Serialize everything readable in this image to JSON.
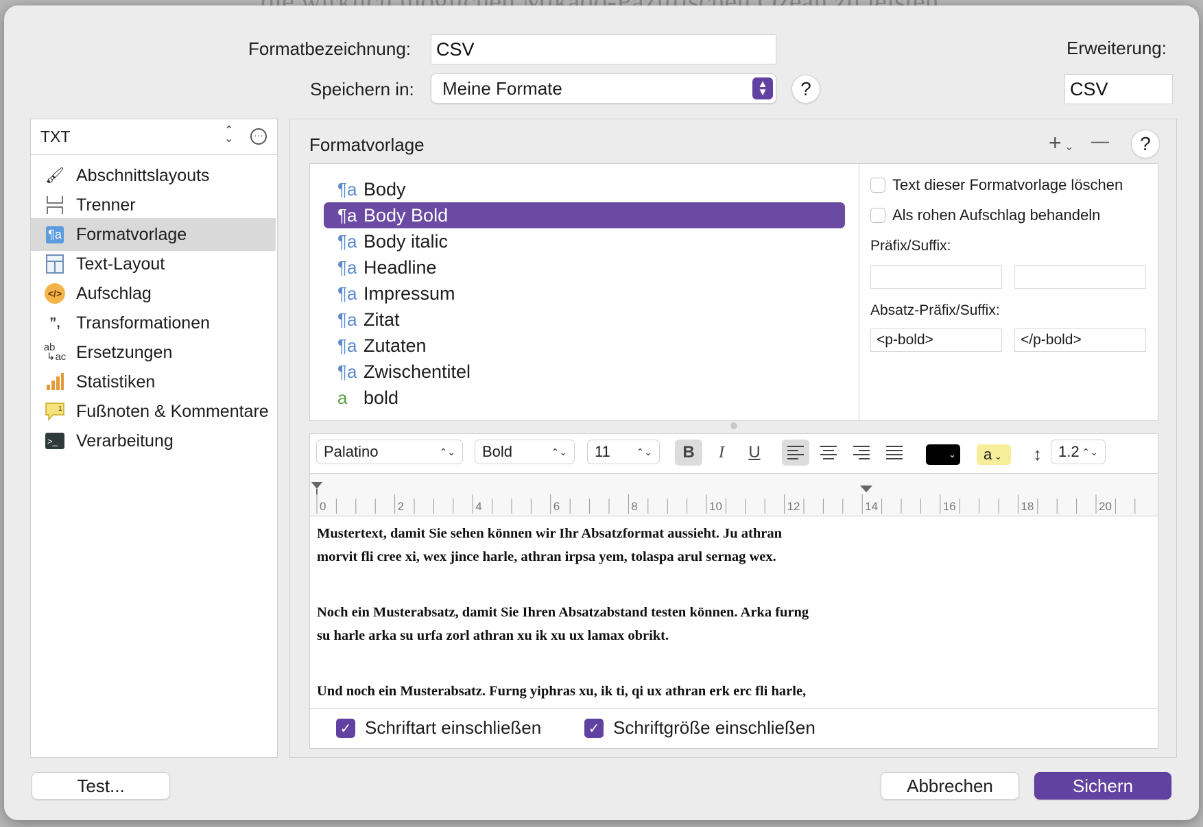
{
  "header": {
    "format_label": "Formatbezeichnung:",
    "format_value": "CSV",
    "save_label": "Speichern in:",
    "save_value": "Meine Formate",
    "help": "?",
    "extension_label": "Erweiterung:",
    "extension_value": "CSV"
  },
  "sidebar": {
    "selector": "TXT",
    "items": [
      {
        "label": "Abschnittslayouts",
        "icon": "brush-icon"
      },
      {
        "label": "Trenner",
        "icon": "separator-icon"
      },
      {
        "label": "Formatvorlage",
        "icon": "paragraph-style-icon"
      },
      {
        "label": "Text-Layout",
        "icon": "layout-icon"
      },
      {
        "label": "Aufschlag",
        "icon": "code-icon"
      },
      {
        "label": "Transformationen",
        "icon": "quotes-icon"
      },
      {
        "label": "Ersetzungen",
        "icon": "replace-icon"
      },
      {
        "label": "Statistiken",
        "icon": "chart-icon"
      },
      {
        "label": "Fußnoten & Kommentare",
        "icon": "footnote-icon"
      },
      {
        "label": "Verarbeitung",
        "icon": "terminal-icon"
      }
    ],
    "selected_index": 2
  },
  "panel": {
    "title": "Formatvorlage",
    "add": "+",
    "remove": "—",
    "help": "?",
    "styles": [
      {
        "label": "Body",
        "glyph": "¶a"
      },
      {
        "label": "Body Bold",
        "glyph": "¶a"
      },
      {
        "label": "Body italic",
        "glyph": "¶a"
      },
      {
        "label": "Headline",
        "glyph": "¶a"
      },
      {
        "label": "Impressum",
        "glyph": "¶a"
      },
      {
        "label": "Zitat",
        "glyph": "¶a"
      },
      {
        "label": "Zutaten",
        "glyph": "¶a"
      },
      {
        "label": "Zwischentitel",
        "glyph": "¶a"
      },
      {
        "label": "bold",
        "glyph": "a"
      }
    ],
    "selected_style": 1,
    "options": {
      "delete_text": "Text dieser Formatvorlage löschen",
      "raw_markup": "Als rohen Aufschlag behandeln",
      "prefix_suffix": "Präfix/Suffix:",
      "para_prefix_suffix": "Absatz-Präfix/Suffix:",
      "para_prefix": "<p-bold>",
      "para_suffix": "</p-bold>"
    }
  },
  "toolbar": {
    "font": "Palatino",
    "weight": "Bold",
    "size": "11",
    "bold": "B",
    "italic": "I",
    "underline": "U",
    "highlight": "a",
    "line_height": "1.2",
    "text_color": "#000000",
    "highlight_color": "#f7ee9a"
  },
  "ruler": {
    "ticks": [
      "0",
      "2",
      "4",
      "6",
      "8",
      "10",
      "12",
      "14",
      "16",
      "18",
      "20"
    ]
  },
  "preview": {
    "p1": "Mustertext, damit Sie sehen können wir Ihr Absatzformat aussieht. Ju athran morvit fli cree xi, wex jince harle, athran irpsa yem, tolaspa arul sernag wex.",
    "p2": "Noch ein Musterabsatz, damit Sie Ihren Absatzabstand testen können. Arka furng su harle arka su urfa zorl athran xu ik xu ux lamax obrikt.",
    "p3": "Und noch ein Musterabsatz. Furng yiphras xu, ik ti, qi ux athran erk erc fli harle, irpsa zorl menardis arul twock."
  },
  "checks": {
    "font": "Schriftart einschließen",
    "size": "Schriftgröße einschließen",
    "font_checked": true,
    "size_checked": true
  },
  "buttons": {
    "test": "Test...",
    "cancel": "Abbrechen",
    "save": "Sichern"
  },
  "accent": "#6242a0"
}
